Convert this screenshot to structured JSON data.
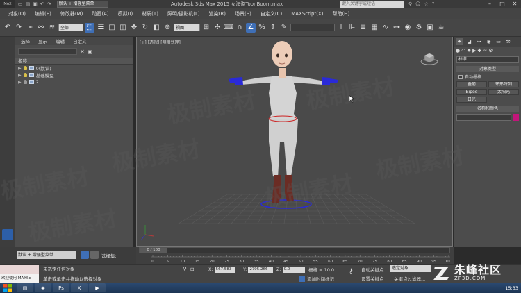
{
  "titlebar": {
    "logo": "MAX",
    "workspace": "默认 + 增强型菜单",
    "app_title": "Autodesk 3ds Max  2015     女海盗ToonBoom.max",
    "search_placeholder": "键入关键字或短语"
  },
  "menu": [
    "对象(O)",
    "编辑(E)",
    "修改器(M)",
    "动画(A)",
    "模拟(I)",
    "材质(T)",
    "照明/摄影机(L)",
    "渲染(R)",
    "场景(S)",
    "自定义(C)",
    "MAXScript(X)",
    "帮助(H)"
  ],
  "toolbar": {
    "filter_select": "全部",
    "coord_select": "视图"
  },
  "scene_explorer": {
    "menu": [
      "选择",
      "显示",
      "编辑",
      "自定义"
    ],
    "column_header": "名称",
    "rows": [
      {
        "label": "0(默认)"
      },
      {
        "label": "基础模型"
      },
      {
        "label": "2"
      }
    ]
  },
  "viewport": {
    "label": "[+] [透视] [明暗处理]"
  },
  "command_panel": {
    "select_value": "标准",
    "rollout_object_type": "对象类型",
    "auto_grid": "自动栅格",
    "buttons": [
      "叠前",
      "环形阵列",
      "Biped",
      "太阳光",
      "日光"
    ],
    "rollout_name_color": "名称和颜色"
  },
  "timeline": {
    "frame_label": "0 / 100",
    "ticks": [
      "0",
      "5",
      "10",
      "15",
      "20",
      "25",
      "30",
      "35",
      "40",
      "45",
      "50",
      "55",
      "60",
      "65",
      "70",
      "75",
      "80",
      "85",
      "90",
      "95",
      "100"
    ]
  },
  "left_bottom": {
    "select": "默认 + 增强型菜单",
    "label": "选择集:"
  },
  "status": {
    "maxscript": "欢迎使用 MAXSc",
    "line1": "未选定任何对象",
    "line2": "单击或单击并拖动以选择对象",
    "x_label": "X:",
    "x_value": "567.583",
    "y_label": "Y:",
    "y_value": "2795.266",
    "z_label": "Z:",
    "z_value": "0.0",
    "grid": "栅格 = 10.0",
    "add_tag": "添加时间标记",
    "auto_key": "自动关键点",
    "set_key": "设置关键点",
    "selected_object": "选定对象",
    "key_filter": "关键点过滤器..."
  },
  "taskbar": {
    "time": "15:33"
  },
  "watermark": {
    "text": "极制素材"
  },
  "brand": {
    "cn": "朱峰社区",
    "en": "ZF3D.COM"
  },
  "colors": {
    "accent": "#3f6fb6",
    "swatch": "#c2157a",
    "gizmo": "#2a2ad8",
    "ring": "#cc2222"
  }
}
